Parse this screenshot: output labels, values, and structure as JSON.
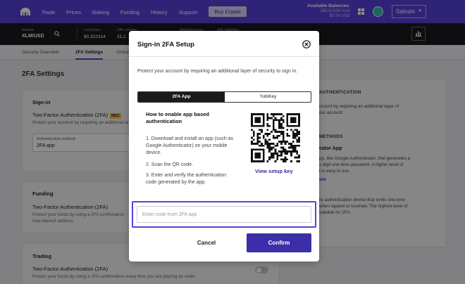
{
  "topnav": {
    "links": [
      "Trade",
      "Prices",
      "Staking",
      "Funding",
      "History",
      "Support"
    ],
    "buy_label": "Buy Crypto",
    "balances_title": "Available Balances:",
    "balance_xlm": "565.61536 XLM",
    "balance_usd": "$0.00 USD",
    "username": "Satoshi"
  },
  "market": {
    "pair_label": "Market",
    "pair": "XLM/USD",
    "last_price_label": "Last price",
    "last_price": "$0.322314",
    "h24_label": "24h volume",
    "h24_value": "31,1",
    "weighted_label": "Weighted avg",
    "h24_high_label": "24h high/low"
  },
  "tabs": [
    "Security Overview",
    "2FA Settings",
    "Global Settings"
  ],
  "page": {
    "title": "2FA Settings",
    "signin": {
      "heading": "Sign-in",
      "title": "Two-Factor Authentication (2FA)",
      "badge": "REC",
      "desc": "Protect your account by requiring an additional layer of security",
      "auth_label": "Authentication method",
      "auth_value": "2FA app"
    },
    "funding": {
      "heading": "Funding",
      "title": "Two-Factor Authentication (2FA)",
      "desc1": "Protect your funds by using a 2FA confirmation",
      "desc2": "new deposit address."
    },
    "trading": {
      "heading": "Trading",
      "title": "Two-Factor Authentication (2FA)",
      "desc": "Protect your funds by using a 2FA confirmation every time you are placing an order."
    }
  },
  "right_panel": {
    "heading": "AUTHENTICATION",
    "text1": "ccount by requiring an additional layer of",
    "text2": "our account.",
    "methods_heading": "METHODS",
    "app_title": "cator App",
    "app_text1": "pp, like Google Authenticator, that generates a",
    "app_text2": "s digit one-time password. A higher level of",
    "app_text3": "t is easy to use.",
    "learn_more": "ore",
    "key_text1": "re authentication device that emits one-time",
    "key_text2": "when tapped or touched. The highest level of",
    "key_text3": "vailable for 2FA."
  },
  "modal": {
    "title": "Sign-in 2FA Setup",
    "description": "Protect your account by requiring an additional layer of security to sign in.",
    "tab_app": "2FA App",
    "tab_key": "YubiKey",
    "how_title": "How to enable app based authentication",
    "steps": [
      "1. Download and install an app (such as Google Authenticator) on your mobile device.",
      "2. Scan the QR code.",
      "3. Enter and verify the authentication code generated by the app."
    ],
    "view_key": "View setup key",
    "code_placeholder": "Enter code from 2FA app",
    "code_value": "",
    "cancel": "Cancel",
    "confirm": "Confirm"
  },
  "colors": {
    "brand": "#5741d9",
    "confirm": "#3b2ea8",
    "market_bar": "#1a1a1e"
  },
  "icons": [
    "logo-icon",
    "grid-icon",
    "avatar-icon",
    "chevron-down-icon",
    "search-icon",
    "chart-icon",
    "close-icon",
    "qr-code"
  ]
}
